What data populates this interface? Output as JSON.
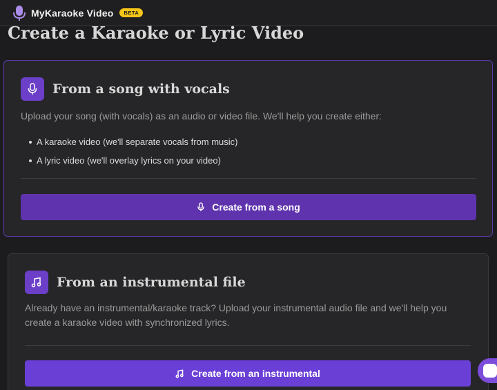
{
  "header": {
    "brand": "MyKaraoke Video",
    "badge": "BETA",
    "logo_icon": "microphone-icon"
  },
  "page": {
    "title": "Create a Karaoke or Lyric Video"
  },
  "cards": [
    {
      "icon": "microphone-icon",
      "title": "From a song with vocals",
      "description": "Upload your song (with vocals) as an audio or video file. We'll help you create either:",
      "bullets": [
        "A karaoke video (we'll separate vocals from music)",
        "A lyric video (we'll overlay lyrics on your video)"
      ],
      "button_label": "Create from a song"
    },
    {
      "icon": "music-note-icon",
      "title": "From an instrumental file",
      "description": "Already have an instrumental/karaoke track? Upload your instrumental audio file and we'll help you create a karaoke video with synchronized lyrics.",
      "button_label": "Create from an instrumental"
    }
  ],
  "colors": {
    "accent": "#6b3fc8",
    "badge": "#f5c518",
    "background": "#1c1c1e"
  }
}
